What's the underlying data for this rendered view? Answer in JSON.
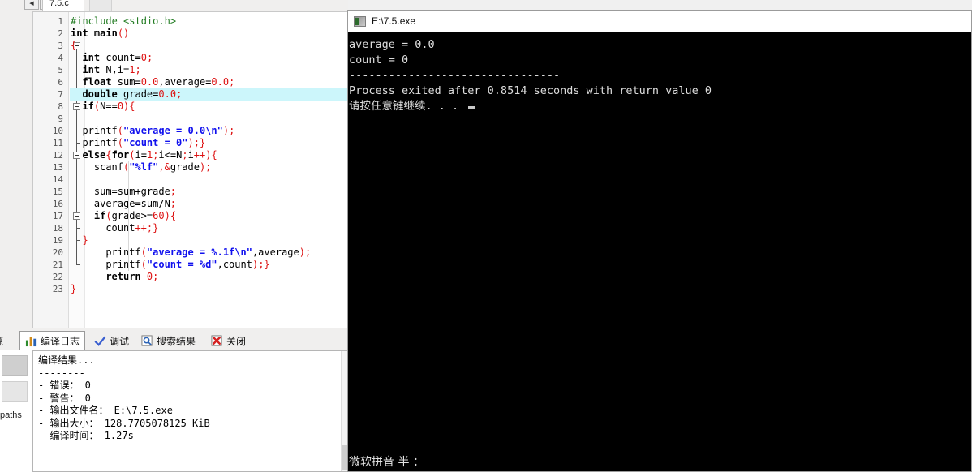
{
  "ide": {
    "nav": {
      "back_label": "◀",
      "forward_label": "▶"
    },
    "file_tab": {
      "label": "7.5.c"
    },
    "editor": {
      "highlight_line": 7,
      "lines": [
        {
          "n": 1,
          "tokens": [
            {
              "t": "#include ",
              "c": "pp"
            },
            {
              "t": "<stdio.h>",
              "c": "pp"
            }
          ],
          "indent": 0
        },
        {
          "n": 2,
          "tokens": [
            {
              "t": "int",
              "c": "kw"
            },
            {
              "t": " ",
              "c": "plain"
            },
            {
              "t": "main",
              "c": "kw"
            },
            {
              "t": "()",
              "c": "pun"
            }
          ],
          "indent": 0
        },
        {
          "n": 3,
          "tokens": [
            {
              "t": "{",
              "c": "pun"
            }
          ],
          "indent": 0
        },
        {
          "n": 4,
          "tokens": [
            {
              "t": "int",
              "c": "kw"
            },
            {
              "t": " count=",
              "c": "plain"
            },
            {
              "t": "0",
              "c": "num"
            },
            {
              "t": ";",
              "c": "pun"
            }
          ],
          "indent": 1
        },
        {
          "n": 5,
          "tokens": [
            {
              "t": "int",
              "c": "kw"
            },
            {
              "t": " N,i=",
              "c": "plain"
            },
            {
              "t": "1",
              "c": "num"
            },
            {
              "t": ";",
              "c": "pun"
            }
          ],
          "indent": 1
        },
        {
          "n": 6,
          "tokens": [
            {
              "t": "float",
              "c": "kw"
            },
            {
              "t": " sum=",
              "c": "plain"
            },
            {
              "t": "0.0",
              "c": "num"
            },
            {
              "t": ",average=",
              "c": "plain"
            },
            {
              "t": "0.0",
              "c": "num"
            },
            {
              "t": ";",
              "c": "pun"
            }
          ],
          "indent": 1
        },
        {
          "n": 7,
          "tokens": [
            {
              "t": "double",
              "c": "kw"
            },
            {
              "t": " grade=",
              "c": "plain"
            },
            {
              "t": "0.0",
              "c": "num"
            },
            {
              "t": ";",
              "c": "pun"
            }
          ],
          "indent": 1
        },
        {
          "n": 8,
          "tokens": [
            {
              "t": "if",
              "c": "kw"
            },
            {
              "t": "(",
              "c": "pun"
            },
            {
              "t": "N==",
              "c": "plain"
            },
            {
              "t": "0",
              "c": "num"
            },
            {
              "t": "){",
              "c": "pun"
            }
          ],
          "indent": 1
        },
        {
          "n": 9,
          "tokens": [],
          "indent": 0
        },
        {
          "n": 10,
          "tokens": [
            {
              "t": "printf",
              "c": "plain"
            },
            {
              "t": "(",
              "c": "pun"
            },
            {
              "t": "\"average = 0.0\\n\"",
              "c": "str"
            },
            {
              "t": ");",
              "c": "pun"
            }
          ],
          "indent": 1
        },
        {
          "n": 11,
          "tokens": [
            {
              "t": "printf",
              "c": "plain"
            },
            {
              "t": "(",
              "c": "pun"
            },
            {
              "t": "\"count = 0\"",
              "c": "str"
            },
            {
              "t": ");}",
              "c": "pun"
            }
          ],
          "indent": 1
        },
        {
          "n": 12,
          "tokens": [
            {
              "t": "else",
              "c": "kw"
            },
            {
              "t": "{",
              "c": "pun"
            },
            {
              "t": "for",
              "c": "kw"
            },
            {
              "t": "(",
              "c": "pun"
            },
            {
              "t": "i=",
              "c": "plain"
            },
            {
              "t": "1",
              "c": "num"
            },
            {
              "t": ";",
              "c": "pun"
            },
            {
              "t": "i<=N",
              "c": "plain"
            },
            {
              "t": ";",
              "c": "pun"
            },
            {
              "t": "i",
              "c": "plain"
            },
            {
              "t": "++",
              "c": "pun"
            },
            {
              "t": "){",
              "c": "pun"
            }
          ],
          "indent": 1
        },
        {
          "n": 13,
          "tokens": [
            {
              "t": "scanf",
              "c": "plain"
            },
            {
              "t": "(",
              "c": "pun"
            },
            {
              "t": "\"%lf\"",
              "c": "str"
            },
            {
              "t": ",",
              "c": "pun"
            },
            {
              "t": "&",
              "c": "pun"
            },
            {
              "t": "grade",
              "c": "plain"
            },
            {
              "t": ");",
              "c": "pun"
            }
          ],
          "indent": 2
        },
        {
          "n": 14,
          "tokens": [],
          "indent": 0
        },
        {
          "n": 15,
          "tokens": [
            {
              "t": "sum=sum+grade",
              "c": "plain"
            },
            {
              "t": ";",
              "c": "pun"
            }
          ],
          "indent": 2
        },
        {
          "n": 16,
          "tokens": [
            {
              "t": "average=sum/N",
              "c": "plain"
            },
            {
              "t": ";",
              "c": "pun"
            }
          ],
          "indent": 2
        },
        {
          "n": 17,
          "tokens": [
            {
              "t": "if",
              "c": "kw"
            },
            {
              "t": "(",
              "c": "pun"
            },
            {
              "t": "grade>=",
              "c": "plain"
            },
            {
              "t": "60",
              "c": "num"
            },
            {
              "t": "){",
              "c": "pun"
            }
          ],
          "indent": 2
        },
        {
          "n": 18,
          "tokens": [
            {
              "t": "count",
              "c": "plain"
            },
            {
              "t": "++;}",
              "c": "pun"
            }
          ],
          "indent": 3
        },
        {
          "n": 19,
          "tokens": [
            {
              "t": "}",
              "c": "pun"
            }
          ],
          "indent": 1
        },
        {
          "n": 20,
          "tokens": [
            {
              "t": "printf",
              "c": "plain"
            },
            {
              "t": "(",
              "c": "pun"
            },
            {
              "t": "\"average = %.1f\\n\"",
              "c": "str"
            },
            {
              "t": ",average",
              "c": "plain"
            },
            {
              "t": ");",
              "c": "pun"
            }
          ],
          "indent": 3
        },
        {
          "n": 21,
          "tokens": [
            {
              "t": "printf",
              "c": "plain"
            },
            {
              "t": "(",
              "c": "pun"
            },
            {
              "t": "\"count = %d\"",
              "c": "str"
            },
            {
              "t": ",count",
              "c": "plain"
            },
            {
              "t": ");}",
              "c": "pun"
            }
          ],
          "indent": 3
        },
        {
          "n": 22,
          "tokens": [
            {
              "t": "return",
              "c": "kw"
            },
            {
              "t": " ",
              "c": "plain"
            },
            {
              "t": "0",
              "c": "num"
            },
            {
              "t": ";",
              "c": "pun"
            }
          ],
          "indent": 3
        },
        {
          "n": 23,
          "tokens": [
            {
              "t": "}",
              "c": "pun"
            }
          ],
          "indent": 0
        }
      ],
      "fold_markers": [
        3,
        8,
        12,
        17
      ]
    },
    "side_stub": {
      "paths_label": "paths"
    },
    "bottom_tabs": [
      {
        "label": "源",
        "icon": "source-icon",
        "active": false
      },
      {
        "label": "编译日志",
        "icon": "compile-log-icon",
        "active": true
      },
      {
        "label": "调试",
        "icon": "debug-check-icon",
        "active": false
      },
      {
        "label": "搜索结果",
        "icon": "search-result-icon",
        "active": false
      },
      {
        "label": "关闭",
        "icon": "close-red-icon",
        "active": false
      }
    ],
    "compile_log": {
      "lines": [
        "编译结果...",
        "--------",
        "- 错误： 0",
        "- 警告： 0",
        "- 输出文件名： E:\\7.5.exe",
        "- 输出大小： 128.7705078125 KiB",
        "- 编译时间： 1.27s"
      ]
    }
  },
  "console": {
    "title": "E:\\7.5.exe",
    "lines": [
      "average = 0.0",
      "count = 0",
      "--------------------------------",
      "",
      "Process exited after 0.8514 seconds with return value 0"
    ],
    "prompt": "请按任意键继续. . .",
    "ime_status": "微软拼音 半 ："
  },
  "colors": {
    "highlight_row": "#ccf6fb",
    "string": "#1010ee",
    "punctuation": "#dd1111",
    "preprocessor": "#1f7a1f",
    "console_bg": "#000000",
    "console_fg": "#dcdcdc"
  }
}
